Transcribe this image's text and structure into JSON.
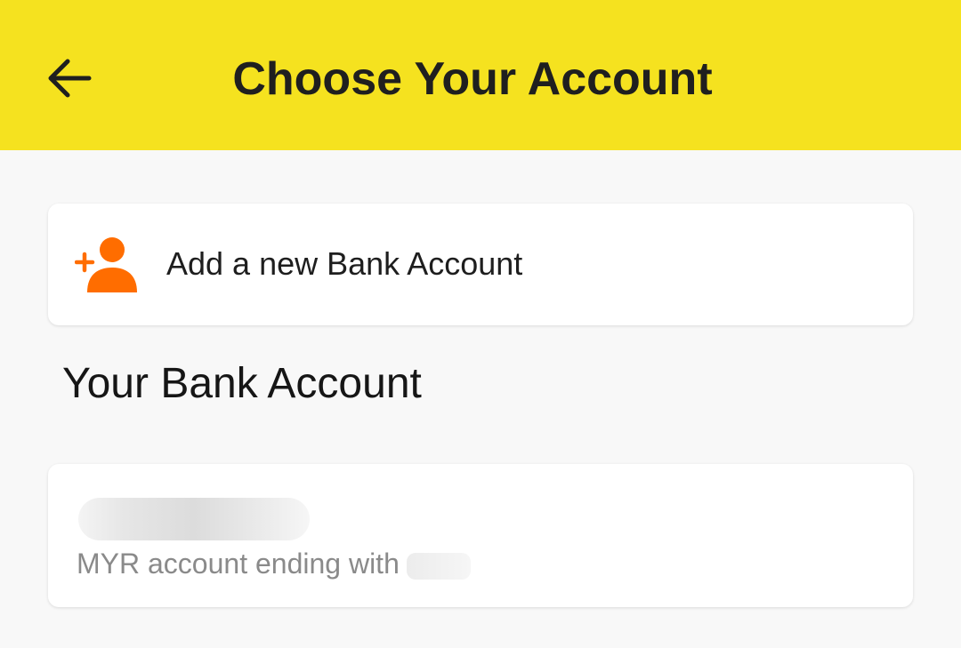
{
  "header": {
    "title": "Choose Your Account",
    "back_icon": "arrow-left-icon",
    "background_color": "#f5e21f"
  },
  "add_account": {
    "label": "Add a new Bank Account",
    "icon": "add-user-icon",
    "icon_color": "#ff6d00"
  },
  "section": {
    "heading": "Your Bank Account"
  },
  "accounts": [
    {
      "name": "",
      "subtitle_prefix": "MYR account ending with"
    }
  ]
}
